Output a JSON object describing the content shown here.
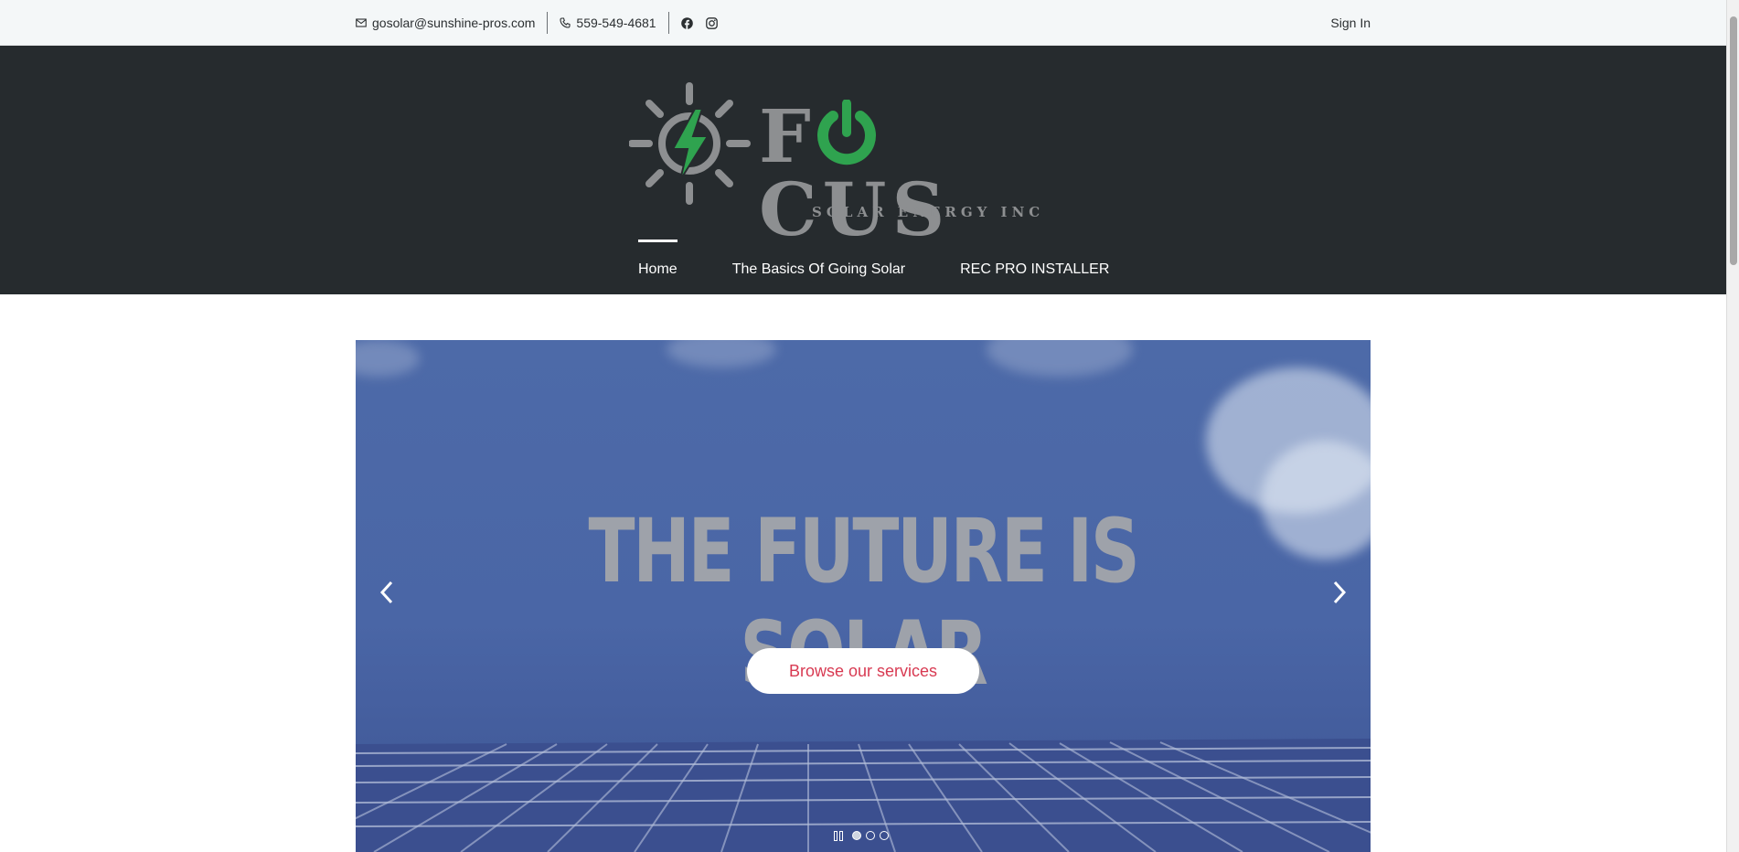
{
  "topbar": {
    "email": "gosolar@sunshine-pros.com",
    "phone": "559-549-4681",
    "social": [
      "facebook-icon",
      "instagram-icon"
    ],
    "signin_label": "Sign In"
  },
  "brand": {
    "name": "FOCUS",
    "tagline": "SOLAR ENERGY INC",
    "colors": {
      "header_bg": "#262b2e",
      "logo_gray": "#8d8f91",
      "logo_green": "#2fa34f"
    }
  },
  "nav": {
    "items": [
      {
        "label": "Home",
        "active": true
      },
      {
        "label": "The Basics Of Going Solar",
        "active": false
      },
      {
        "label": "REC PRO INSTALLER",
        "active": false
      }
    ]
  },
  "hero": {
    "title": "THE FUTURE IS SOLAR",
    "button_label": "Browse our services",
    "slide_count": 3,
    "active_slide": 1,
    "colors": {
      "button_text": "#d83a52"
    }
  }
}
